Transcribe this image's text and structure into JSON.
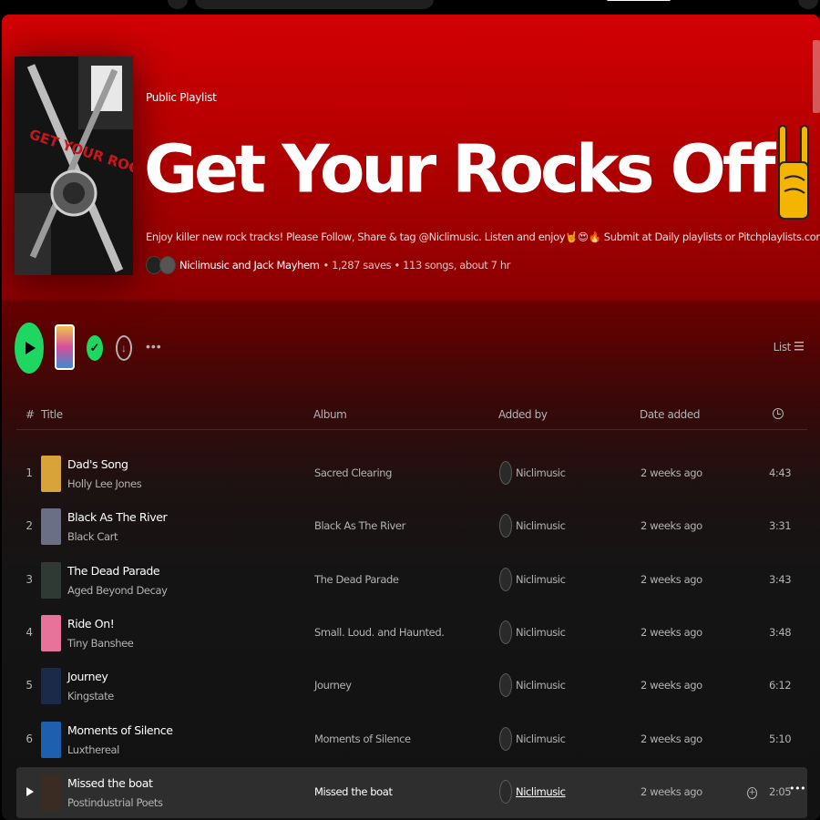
{
  "playlist": {
    "kind": "Public Playlist",
    "title": "Get Your Rocks Off",
    "title_emoji": "rock-on-hand-emoji",
    "description": "Enjoy killer new rock tracks! Please Follow, Share & tag @Niclimusic. Listen and enjoy🤘😍🔥 Submit at Daily playlists or Pitchplaylists.com",
    "owners": "Niclimusic and Jack Mayhem",
    "stats": "• 1,287 saves • 113 songs, about 7 hr",
    "cover_text": "GET YOUR ROCKS OFF"
  },
  "actions": {
    "view_mode": "List"
  },
  "table": {
    "headers": {
      "num": "#",
      "title": "Title",
      "album": "Album",
      "added_by": "Added by",
      "date_added": "Date added"
    },
    "tracks": [
      {
        "num": "1",
        "title": "Dad's Song",
        "artist": "Holly Lee Jones",
        "album": "Sacred Clearing",
        "added_by": "Niclimusic",
        "date": "2 weeks ago",
        "duration": "4:43",
        "art_color": "#d8a43a"
      },
      {
        "num": "2",
        "title": "Black As The River",
        "artist": "Black Cart",
        "album": "Black As The River",
        "added_by": "Niclimusic",
        "date": "2 weeks ago",
        "duration": "3:31",
        "art_color": "#6b6f86"
      },
      {
        "num": "3",
        "title": "The Dead Parade",
        "artist": "Aged Beyond Decay",
        "album": "The Dead Parade",
        "added_by": "Niclimusic",
        "date": "2 weeks ago",
        "duration": "3:43",
        "art_color": "#2e3a33"
      },
      {
        "num": "4",
        "title": "Ride On!",
        "artist": "Tiny Banshee",
        "album": "Small. Loud. and Haunted.",
        "added_by": "Niclimusic",
        "date": "2 weeks ago",
        "duration": "3:48",
        "art_color": "#e8739a"
      },
      {
        "num": "5",
        "title": "Journey",
        "artist": "Kingstate",
        "album": "Journey",
        "added_by": "Niclimusic",
        "date": "2 weeks ago",
        "duration": "6:12",
        "art_color": "#1c2a4a"
      },
      {
        "num": "6",
        "title": "Moments of Silence",
        "artist": "Luxthereal",
        "album": "Moments of Silence",
        "added_by": "Niclimusic",
        "date": "2 weeks ago",
        "duration": "5:10",
        "art_color": "#1f5fb0"
      },
      {
        "num": "7",
        "title": "Missed the boat",
        "artist": "Postindustrial Poets",
        "album": "Missed the boat",
        "added_by": "Niclimusic",
        "date": "2 weeks ago",
        "duration": "2:05",
        "art_color": "#3a2c22"
      }
    ]
  },
  "colors": {
    "accent": "#1ed760",
    "header_red": "#d20004",
    "background": "#121212"
  }
}
